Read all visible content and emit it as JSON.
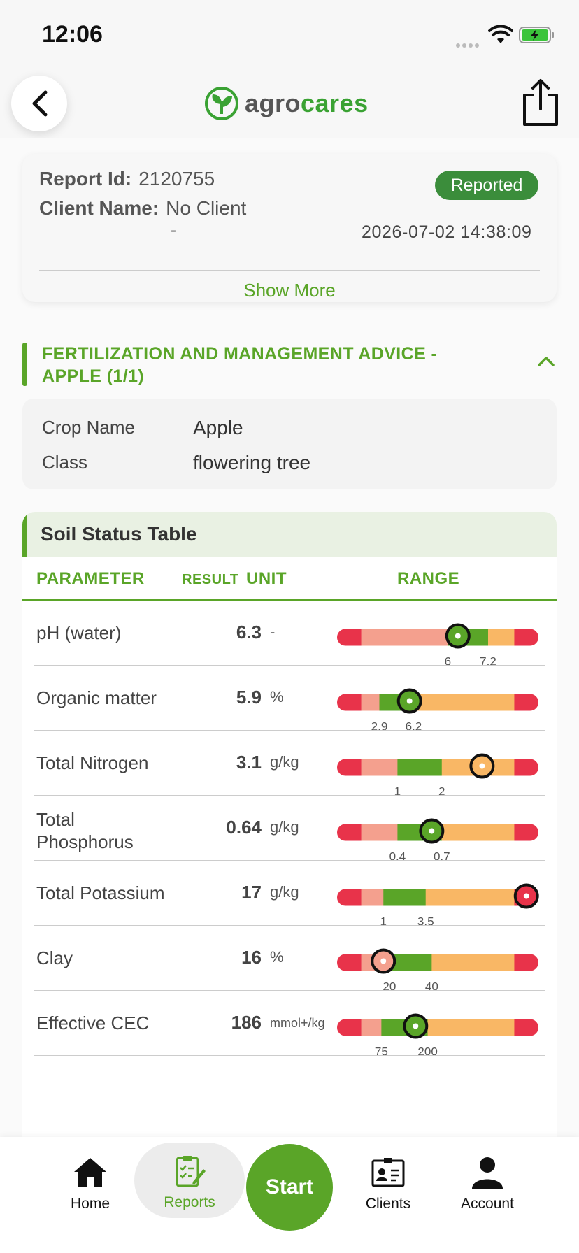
{
  "status_bar": {
    "time": "12:06"
  },
  "header": {
    "logo_text_a": "agro",
    "logo_text_b": "cares"
  },
  "report": {
    "id_label": "Report Id:",
    "id_value": "2120755",
    "client_label": "Client Name:",
    "client_value": "No Client",
    "client_sub": "-",
    "status": "Reported",
    "datetime": "2026-07-02 14:38:09",
    "show_more": "Show More"
  },
  "section": {
    "title": "FERTILIZATION AND MANAGEMENT ADVICE - APPLE (1/1)"
  },
  "crop": {
    "name_label": "Crop Name",
    "name_value": "Apple",
    "class_label": "Class",
    "class_value": "flowering tree"
  },
  "soil": {
    "title": "Soil Status Table",
    "col_parameter": "PARAMETER",
    "col_result": "RESULT",
    "col_unit": "UNIT",
    "col_range": "RANGE",
    "rows": [
      {
        "name": "pH (water)",
        "result": "6.3",
        "unit": "-",
        "low": "6",
        "high": "7.2",
        "zones": [
          0.12,
          0.55,
          0.75,
          0.88
        ],
        "marker": 0.6,
        "marker_color": "#5aa528"
      },
      {
        "name": "Organic matter",
        "result": "5.9",
        "unit": "%",
        "low": "2.9",
        "high": "6.2",
        "zones": [
          0.12,
          0.21,
          0.38,
          0.88
        ],
        "marker": 0.36,
        "marker_color": "#5aa528"
      },
      {
        "name": "Total Nitrogen",
        "result": "3.1",
        "unit": "g/kg",
        "low": "1",
        "high": "2",
        "zones": [
          0.12,
          0.3,
          0.52,
          0.88
        ],
        "marker": 0.72,
        "marker_color": "#f9b765"
      },
      {
        "name": "Total Phosphorus",
        "result": "0.64",
        "unit": "g/kg",
        "low": "0.4",
        "high": "0.7",
        "zones": [
          0.12,
          0.3,
          0.52,
          0.88
        ],
        "marker": 0.47,
        "marker_color": "#5aa528"
      },
      {
        "name": "Total Potassium",
        "result": "17",
        "unit": "g/kg",
        "low": "1",
        "high": "3.5",
        "zones": [
          0.12,
          0.23,
          0.44,
          0.88
        ],
        "marker": 0.94,
        "marker_color": "#e8334a"
      },
      {
        "name": "Clay",
        "result": "16",
        "unit": "%",
        "low": "20",
        "high": "40",
        "zones": [
          0.12,
          0.26,
          0.47,
          0.88
        ],
        "marker": 0.23,
        "marker_color": "#f4a08e"
      },
      {
        "name": "Effective CEC",
        "result": "186",
        "unit": "mmol+/kg",
        "low": "75",
        "high": "200",
        "zones": [
          0.12,
          0.22,
          0.45,
          0.88
        ],
        "marker": 0.39,
        "marker_color": "#5aa528"
      }
    ]
  },
  "nav": {
    "home": "Home",
    "reports": "Reports",
    "start": "Start",
    "clients": "Clients",
    "account": "Account"
  },
  "colors": {
    "accent": "#5aa528",
    "badge": "#3b8d3b",
    "range_red": "#e8334a",
    "range_pink": "#f4a08e",
    "range_green": "#5aa528",
    "range_orange": "#f9b765"
  }
}
